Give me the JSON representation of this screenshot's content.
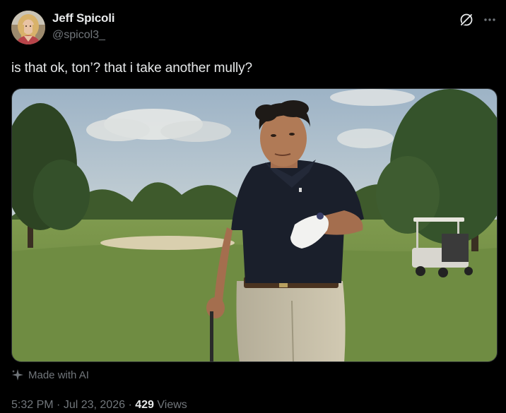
{
  "tweet": {
    "author": {
      "display_name": "Jeff Spicoli",
      "handle": "@spicol3_",
      "avatar_icon": "avatar"
    },
    "text": "is that ok, ton’? that i take another mully?",
    "media": {
      "alt": "golf course image"
    },
    "ai_label": "Made with AI",
    "meta": {
      "time": "5:32 PM",
      "separator": " · ",
      "date": "Jul 23, 2026",
      "views_count": "429",
      "views_label": "Views"
    },
    "icons": {
      "grok": "grok-icon",
      "more": "more-icon",
      "sparkle": "sparkle-icon"
    }
  },
  "colors": {
    "background": "#000000",
    "primary_text": "#e7e9ea",
    "secondary_text": "#71767b",
    "border": "#2f3336"
  }
}
